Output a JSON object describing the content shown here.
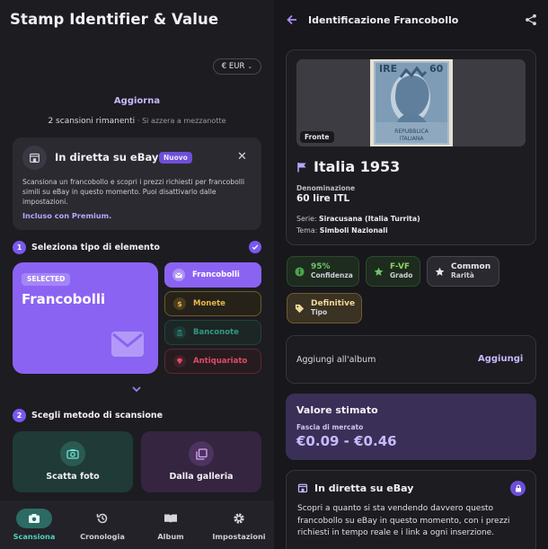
{
  "left": {
    "app_title": "Stamp Identifier & Value",
    "currency": "€ EUR",
    "update_link": "Aggiorna",
    "scans_remaining": "2 scansioni rimanenti",
    "scans_reset": "· Si azzera a mezzanotte",
    "ebay_banner": {
      "title": "In diretta su eBay",
      "badge": "Nuovo",
      "description": "Scansiona un francobollo e scopri i prezzi richiesti per francobolli simili su eBay in questo momento. Puoi disattivarlo dalle impostazioni.",
      "premium": "Incluso con Premium."
    },
    "step1": {
      "num": "1",
      "label": "Seleziona tipo di elemento"
    },
    "selected_card": {
      "badge": "SELECTED",
      "name": "Francobolli"
    },
    "types": [
      {
        "label": "Francobolli",
        "icon": "envelope-icon"
      },
      {
        "label": "Monete",
        "icon": "dollar-coin-icon"
      },
      {
        "label": "Banconote",
        "icon": "bank-icon"
      },
      {
        "label": "Antiquariato",
        "icon": "gem-icon"
      }
    ],
    "step2": {
      "num": "2",
      "label": "Scegli metodo di scansione"
    },
    "methods": [
      {
        "label": "Scatta foto",
        "icon": "camera-icon"
      },
      {
        "label": "Dalla galleria",
        "icon": "gallery-icon"
      }
    ],
    "nav": [
      {
        "label": "Scansiona",
        "icon": "camera-icon",
        "active": true
      },
      {
        "label": "Cronologia",
        "icon": "history-icon",
        "active": false
      },
      {
        "label": "Album",
        "icon": "book-icon",
        "active": false
      },
      {
        "label": "Impostazioni",
        "icon": "gear-icon",
        "active": false
      }
    ]
  },
  "right": {
    "title": "Identificazione Francobollo",
    "image_badge": "Fronte",
    "stamp_text": {
      "top_left": "IRE",
      "top_right": "60",
      "bottom1": "REPUBBLICA",
      "bottom2": "ITALIANA"
    },
    "country_year": "Italia 1953",
    "denomination_label": "Denominazione",
    "denomination_value": "60 lire ITL",
    "series_label": "Serie:",
    "series_value": "Siracusana (Italia Turrita)",
    "theme_label": "Tema:",
    "theme_value": "Simboli Nazionali",
    "chips": [
      {
        "value": "95%",
        "label": "Confidenza",
        "icon": "info-icon"
      },
      {
        "value": "F-VF",
        "label": "Grado",
        "icon": "star-icon"
      },
      {
        "value": "Common",
        "label": "Rarità",
        "icon": "star-icon"
      },
      {
        "value": "Definitive",
        "label": "Tipo",
        "icon": "tag-icon"
      }
    ],
    "album": {
      "label": "Aggiungi all'album",
      "button": "Aggiungi"
    },
    "value": {
      "title": "Valore stimato",
      "subtitle": "Fascia di mercato",
      "range": "€0.09 - €0.46"
    },
    "live": {
      "title": "In diretta su eBay",
      "description": "Scopri a quanto si sta vendendo davvero questo francobollo su eBay in questo momento, con i prezzi richiesti in tempo reale e i link a ogni inserzione."
    }
  },
  "colors": {
    "accent": "#8b63f3",
    "teal": "#4fd0be",
    "gold": "#e8b64a",
    "red": "#e04a67"
  }
}
